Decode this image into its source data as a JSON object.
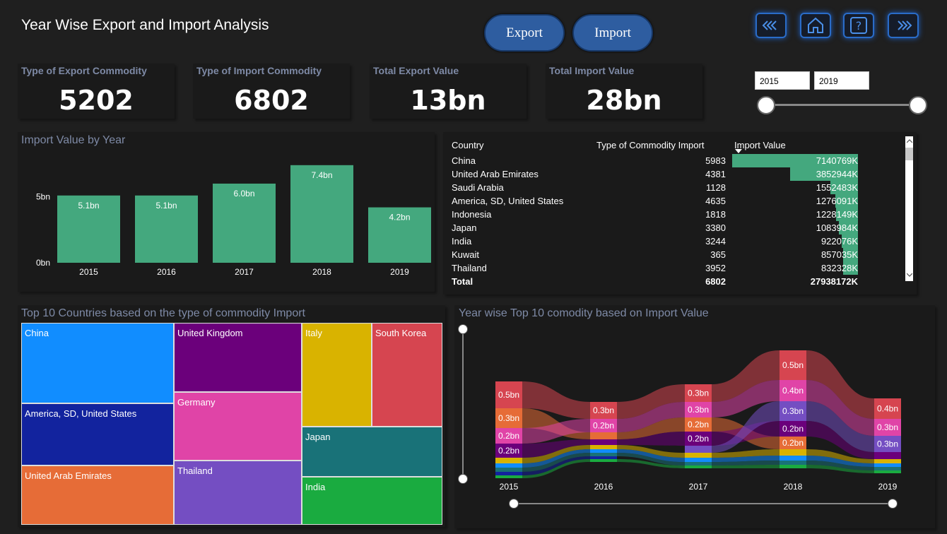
{
  "header": {
    "title": "Year Wise Export and Import Analysis",
    "export_label": "Export",
    "import_label": "Import"
  },
  "nav": {
    "icons": [
      "double-chevron-left-icon",
      "home-icon",
      "help-icon",
      "double-chevron-right-icon"
    ],
    "accent": "#2a6cc8"
  },
  "kpis": [
    {
      "label": "Type of Export Commodity",
      "value": "5202"
    },
    {
      "label": "Type of Import Commodity",
      "value": "6802"
    },
    {
      "label": "Total Export Value",
      "value": "13bn"
    },
    {
      "label": "Total Import Value",
      "value": "28bn"
    }
  ],
  "year_filter": {
    "start": "2015",
    "end": "2019"
  },
  "import_by_year": {
    "title": "Import Value by Year",
    "chart_data": {
      "type": "bar",
      "categories": [
        "2015",
        "2016",
        "2017",
        "2018",
        "2019"
      ],
      "values": [
        5.1,
        5.1,
        6.0,
        7.4,
        4.2
      ],
      "data_labels": [
        "5.1bn",
        "5.1bn",
        "6.0bn",
        "7.4bn",
        "4.2bn"
      ],
      "y_ticks": [
        "0bn",
        "5bn"
      ],
      "ylim": [
        0,
        8.3
      ],
      "color": "#44a87e"
    }
  },
  "country_table": {
    "headers": [
      "Country",
      "Type of Commodity Import",
      "Import Value"
    ],
    "rows": [
      {
        "country": "China",
        "types": "5983",
        "value": "7140769K",
        "v": 7140769
      },
      {
        "country": "United Arab Emirates",
        "types": "4381",
        "value": "3852944K",
        "v": 3852944
      },
      {
        "country": "Saudi Arabia",
        "types": "1128",
        "value": "1552483K",
        "v": 1552483
      },
      {
        "country": "America, SD, United States",
        "types": "4635",
        "value": "1276091K",
        "v": 1276091
      },
      {
        "country": "Indonesia",
        "types": "1818",
        "value": "1228149K",
        "v": 1228149
      },
      {
        "country": "Japan",
        "types": "3380",
        "value": "1083984K",
        "v": 1083984
      },
      {
        "country": "India",
        "types": "3244",
        "value": "922076K",
        "v": 922076
      },
      {
        "country": "Kuwait",
        "types": "365",
        "value": "857035K",
        "v": 857035
      },
      {
        "country": "Thailand",
        "types": "3952",
        "value": "832328K",
        "v": 832328
      }
    ],
    "total": {
      "label": "Total",
      "types": "6802",
      "value": "27938172K"
    },
    "bar_color": "#44a87e"
  },
  "treemap": {
    "title": "Top 10 Countries based on the type of commodity Import",
    "items": [
      {
        "label": "China",
        "color": "#118dff"
      },
      {
        "label": "America, SD, United States",
        "color": "#12239e"
      },
      {
        "label": "United Arab Emirates",
        "color": "#e66c37"
      },
      {
        "label": "United Kingdom",
        "color": "#6b007b"
      },
      {
        "label": "Germany",
        "color": "#e044a7"
      },
      {
        "label": "Thailand",
        "color": "#744ec2"
      },
      {
        "label": "Italy",
        "color": "#d9b300"
      },
      {
        "label": "South Korea",
        "color": "#d64550"
      },
      {
        "label": "Japan",
        "color": "#197278"
      },
      {
        "label": "India",
        "color": "#1aab40"
      }
    ]
  },
  "ribbon": {
    "title": "Year wise Top 10 comodity based on Import Value",
    "chart_data": {
      "type": "area",
      "categories": [
        "2015",
        "2016",
        "2017",
        "2018",
        "2019"
      ],
      "stack_labels": [
        [
          "0.5bn",
          "0.3bn",
          "0.2bn",
          "0.2bn"
        ],
        [
          "0.3bn",
          "0.2bn"
        ],
        [
          "0.3bn",
          "0.3bn",
          "0.2bn",
          "0.2bn"
        ],
        [
          "0.5bn",
          "0.4bn",
          "0.3bn",
          "0.2bn",
          "0.2bn"
        ],
        [
          "0.4bn",
          "0.3bn",
          "0.3bn"
        ]
      ],
      "colors": [
        "#d64550",
        "#e044a7",
        "#744ec2",
        "#6b007b",
        "#e66c37",
        "#d9b300",
        "#197278",
        "#118dff",
        "#12239e",
        "#1aab40"
      ]
    }
  }
}
